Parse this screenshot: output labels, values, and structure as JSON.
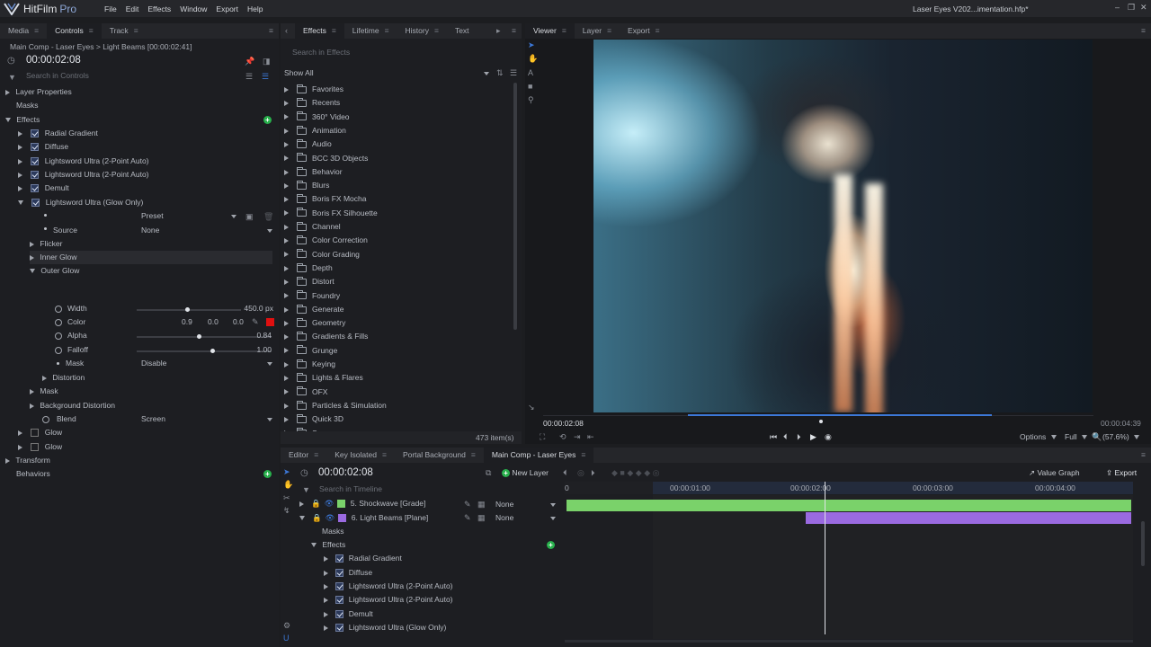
{
  "app": {
    "brand": "HitFilm",
    "edition": "Pro",
    "project_title": "Laser Eyes V202...imentation.hfp*"
  },
  "menu": [
    "File",
    "Edit",
    "Effects",
    "Window",
    "Export",
    "Help"
  ],
  "left_panel": {
    "tabs": [
      "Media",
      "Controls",
      "Track"
    ],
    "breadcrumb": "Main Comp - Laser Eyes > Light Beams [00:00:02:41]",
    "timecode": "00:00:02:08",
    "search_placeholder": "Search in Controls",
    "tree": {
      "layer_properties": "Layer Properties",
      "masks": "Masks",
      "effects": "Effects",
      "radial_gradient": "Radial Gradient",
      "diffuse": "Diffuse",
      "lightsword_1": "Lightsword Ultra (2-Point Auto)",
      "lightsword_2": "Lightsword Ultra (2-Point Auto)",
      "demult": "Demult",
      "lightsword_glow": "Lightsword Ultra (Glow Only)",
      "preset_label": "Preset",
      "source_label": "Source",
      "source_value": "None",
      "flicker": "Flicker",
      "inner_glow": "Inner Glow",
      "outer_glow": "Outer Glow",
      "width_label": "Width",
      "width_value": "450.0 px",
      "color_label": "Color",
      "color_r": "0.9",
      "color_g": "0.0",
      "color_b": "0.0",
      "alpha_label": "Alpha",
      "alpha_value": "0.84",
      "falloff_label": "Falloff",
      "falloff_value": "1.00",
      "mask_label": "Mask",
      "mask_value": "Disable",
      "distortion": "Distortion",
      "mask": "Mask",
      "background_distortion": "Background Distortion",
      "blend_label": "Blend",
      "blend_value": "Screen",
      "glow_1": "Glow",
      "glow_2": "Glow",
      "transform": "Transform",
      "behaviors": "Behaviors"
    },
    "sliders": {
      "width": 0.49,
      "alpha": 0.46,
      "falloff": 0.56
    }
  },
  "effects_panel": {
    "tabs": [
      "Effects",
      "Lifetime",
      "History",
      "Text"
    ],
    "search_placeholder": "Search in Effects",
    "filter": "Show All",
    "items": [
      "Favorites",
      "Recents",
      "360° Video",
      "Animation",
      "Audio",
      "BCC 3D Objects",
      "Behavior",
      "Blurs",
      "Boris FX Mocha",
      "Boris FX Silhouette",
      "Channel",
      "Color Correction",
      "Color Grading",
      "Depth",
      "Distort",
      "Foundry",
      "Generate",
      "Geometry",
      "Gradients & Fills",
      "Grunge",
      "Keying",
      "Lights & Flares",
      "OFX",
      "Particles & Simulation",
      "Quick 3D",
      "Scene"
    ],
    "count": "473 item(s)"
  },
  "viewer": {
    "tabs": [
      "Viewer",
      "Layer",
      "Export"
    ],
    "timecode_current": "00:00:02:08",
    "timecode_end": "00:00:04:39",
    "options": "Options",
    "quality": "Full",
    "zoom": "(57.6%)",
    "playhead": 0.505
  },
  "timeline": {
    "tabs": [
      "Editor",
      "Key Isolated",
      "Portal Background",
      "Main Comp - Laser Eyes"
    ],
    "timecode": "00:00:02:08",
    "new_layer": "New Layer",
    "value_graph": "Value Graph",
    "export": "Export",
    "search_placeholder": "Search in Timeline",
    "ruler": [
      "0",
      "00:00:01:00",
      "00:00:02:00",
      "00:00:03:00",
      "00:00:04:00"
    ],
    "layers": [
      {
        "name": "5. Shockwave [Grade]",
        "blend": "None",
        "color": "#7ad26a"
      },
      {
        "name": "6. Light Beams [Plane]",
        "blend": "None",
        "color": "#9a6ae0"
      }
    ],
    "sub": {
      "masks": "Masks",
      "effects": "Effects",
      "items": [
        "Radial Gradient",
        "Diffuse",
        "Lightsword Ultra (2-Point Auto)",
        "Lightsword Ultra (2-Point Auto)",
        "Demult",
        "Lightsword Ultra (Glow Only)"
      ]
    },
    "playhead": 0.458
  },
  "colors": {
    "accent": "#3c78d8",
    "color_swatch": "#e01010",
    "clip_green": "#7ad26a",
    "clip_purple": "#9a6ae0"
  }
}
